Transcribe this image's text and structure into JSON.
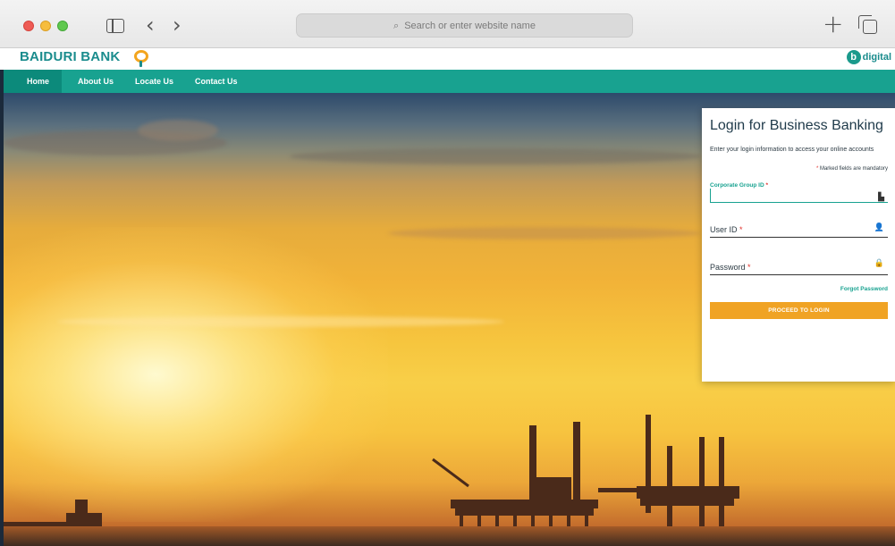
{
  "browser": {
    "address_placeholder": "Search or enter website name"
  },
  "site": {
    "brand_name": "BAIDURI BANK",
    "digital_logo_text": "digital",
    "digital_logo_letter": "b"
  },
  "nav": {
    "items": [
      "Home",
      "About Us",
      "Locate Us",
      "Contact Us"
    ],
    "active": "Home"
  },
  "login": {
    "title": "Login for Business Banking",
    "subtitle": "Enter your login information to access your online accounts",
    "mandatory_note": "Marked fields are mandatory",
    "fields": [
      {
        "label": "Corporate Group ID",
        "value": "",
        "icon": "building-icon"
      },
      {
        "label": "User ID",
        "value": "",
        "icon": "user-icon"
      },
      {
        "label": "Password",
        "value": "",
        "icon": "lock-icon"
      }
    ],
    "required_mark": "*",
    "forgot_password": "Forgot Password",
    "submit_label": "PROCEED TO LOGIN"
  },
  "colors": {
    "brand_teal": "#18a290",
    "accent_orange": "#f0a324"
  }
}
